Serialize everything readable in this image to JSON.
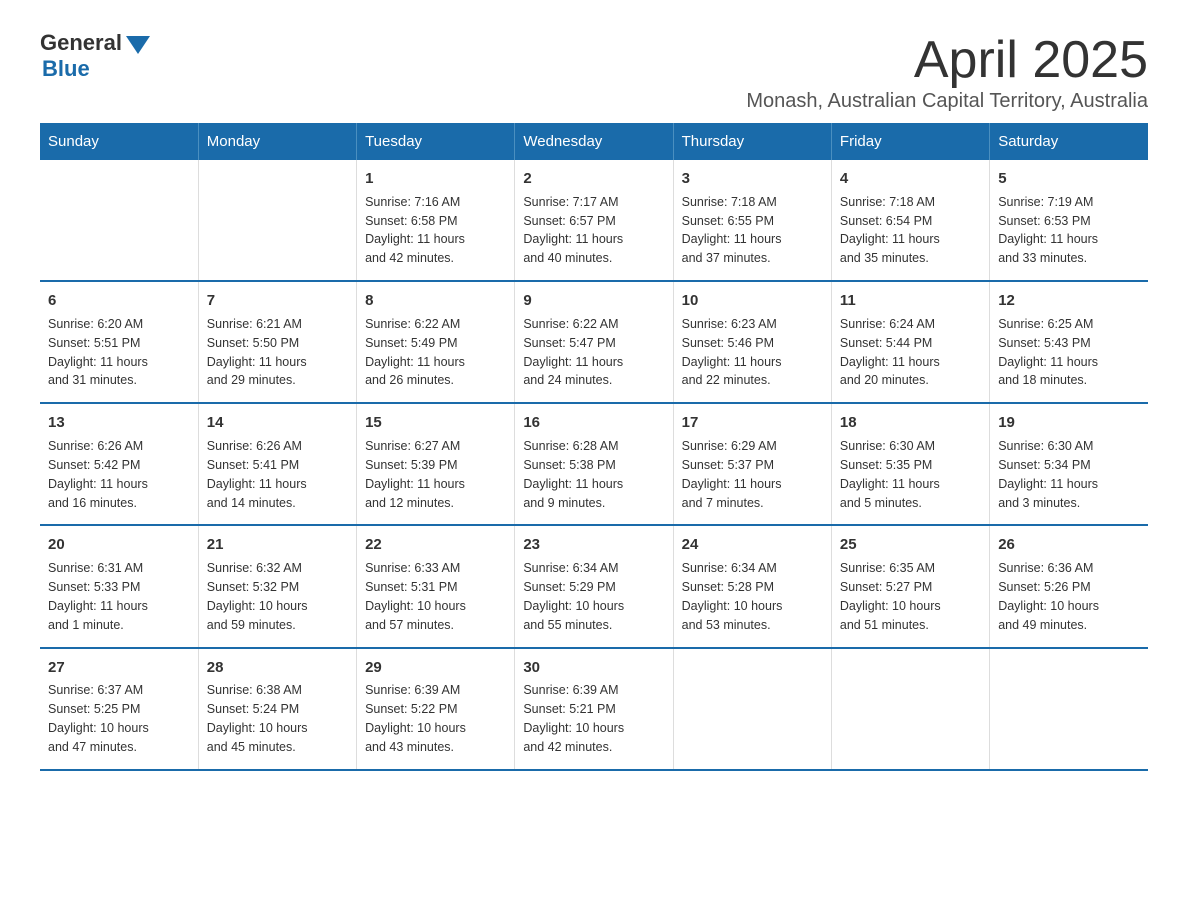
{
  "logo": {
    "general": "General",
    "blue": "Blue"
  },
  "title": "April 2025",
  "subtitle": "Monash, Australian Capital Territory, Australia",
  "days_of_week": [
    "Sunday",
    "Monday",
    "Tuesday",
    "Wednesday",
    "Thursday",
    "Friday",
    "Saturday"
  ],
  "weeks": [
    [
      {
        "day": "",
        "info": ""
      },
      {
        "day": "",
        "info": ""
      },
      {
        "day": "1",
        "info": "Sunrise: 7:16 AM\nSunset: 6:58 PM\nDaylight: 11 hours\nand 42 minutes."
      },
      {
        "day": "2",
        "info": "Sunrise: 7:17 AM\nSunset: 6:57 PM\nDaylight: 11 hours\nand 40 minutes."
      },
      {
        "day": "3",
        "info": "Sunrise: 7:18 AM\nSunset: 6:55 PM\nDaylight: 11 hours\nand 37 minutes."
      },
      {
        "day": "4",
        "info": "Sunrise: 7:18 AM\nSunset: 6:54 PM\nDaylight: 11 hours\nand 35 minutes."
      },
      {
        "day": "5",
        "info": "Sunrise: 7:19 AM\nSunset: 6:53 PM\nDaylight: 11 hours\nand 33 minutes."
      }
    ],
    [
      {
        "day": "6",
        "info": "Sunrise: 6:20 AM\nSunset: 5:51 PM\nDaylight: 11 hours\nand 31 minutes."
      },
      {
        "day": "7",
        "info": "Sunrise: 6:21 AM\nSunset: 5:50 PM\nDaylight: 11 hours\nand 29 minutes."
      },
      {
        "day": "8",
        "info": "Sunrise: 6:22 AM\nSunset: 5:49 PM\nDaylight: 11 hours\nand 26 minutes."
      },
      {
        "day": "9",
        "info": "Sunrise: 6:22 AM\nSunset: 5:47 PM\nDaylight: 11 hours\nand 24 minutes."
      },
      {
        "day": "10",
        "info": "Sunrise: 6:23 AM\nSunset: 5:46 PM\nDaylight: 11 hours\nand 22 minutes."
      },
      {
        "day": "11",
        "info": "Sunrise: 6:24 AM\nSunset: 5:44 PM\nDaylight: 11 hours\nand 20 minutes."
      },
      {
        "day": "12",
        "info": "Sunrise: 6:25 AM\nSunset: 5:43 PM\nDaylight: 11 hours\nand 18 minutes."
      }
    ],
    [
      {
        "day": "13",
        "info": "Sunrise: 6:26 AM\nSunset: 5:42 PM\nDaylight: 11 hours\nand 16 minutes."
      },
      {
        "day": "14",
        "info": "Sunrise: 6:26 AM\nSunset: 5:41 PM\nDaylight: 11 hours\nand 14 minutes."
      },
      {
        "day": "15",
        "info": "Sunrise: 6:27 AM\nSunset: 5:39 PM\nDaylight: 11 hours\nand 12 minutes."
      },
      {
        "day": "16",
        "info": "Sunrise: 6:28 AM\nSunset: 5:38 PM\nDaylight: 11 hours\nand 9 minutes."
      },
      {
        "day": "17",
        "info": "Sunrise: 6:29 AM\nSunset: 5:37 PM\nDaylight: 11 hours\nand 7 minutes."
      },
      {
        "day": "18",
        "info": "Sunrise: 6:30 AM\nSunset: 5:35 PM\nDaylight: 11 hours\nand 5 minutes."
      },
      {
        "day": "19",
        "info": "Sunrise: 6:30 AM\nSunset: 5:34 PM\nDaylight: 11 hours\nand 3 minutes."
      }
    ],
    [
      {
        "day": "20",
        "info": "Sunrise: 6:31 AM\nSunset: 5:33 PM\nDaylight: 11 hours\nand 1 minute."
      },
      {
        "day": "21",
        "info": "Sunrise: 6:32 AM\nSunset: 5:32 PM\nDaylight: 10 hours\nand 59 minutes."
      },
      {
        "day": "22",
        "info": "Sunrise: 6:33 AM\nSunset: 5:31 PM\nDaylight: 10 hours\nand 57 minutes."
      },
      {
        "day": "23",
        "info": "Sunrise: 6:34 AM\nSunset: 5:29 PM\nDaylight: 10 hours\nand 55 minutes."
      },
      {
        "day": "24",
        "info": "Sunrise: 6:34 AM\nSunset: 5:28 PM\nDaylight: 10 hours\nand 53 minutes."
      },
      {
        "day": "25",
        "info": "Sunrise: 6:35 AM\nSunset: 5:27 PM\nDaylight: 10 hours\nand 51 minutes."
      },
      {
        "day": "26",
        "info": "Sunrise: 6:36 AM\nSunset: 5:26 PM\nDaylight: 10 hours\nand 49 minutes."
      }
    ],
    [
      {
        "day": "27",
        "info": "Sunrise: 6:37 AM\nSunset: 5:25 PM\nDaylight: 10 hours\nand 47 minutes."
      },
      {
        "day": "28",
        "info": "Sunrise: 6:38 AM\nSunset: 5:24 PM\nDaylight: 10 hours\nand 45 minutes."
      },
      {
        "day": "29",
        "info": "Sunrise: 6:39 AM\nSunset: 5:22 PM\nDaylight: 10 hours\nand 43 minutes."
      },
      {
        "day": "30",
        "info": "Sunrise: 6:39 AM\nSunset: 5:21 PM\nDaylight: 10 hours\nand 42 minutes."
      },
      {
        "day": "",
        "info": ""
      },
      {
        "day": "",
        "info": ""
      },
      {
        "day": "",
        "info": ""
      }
    ]
  ]
}
